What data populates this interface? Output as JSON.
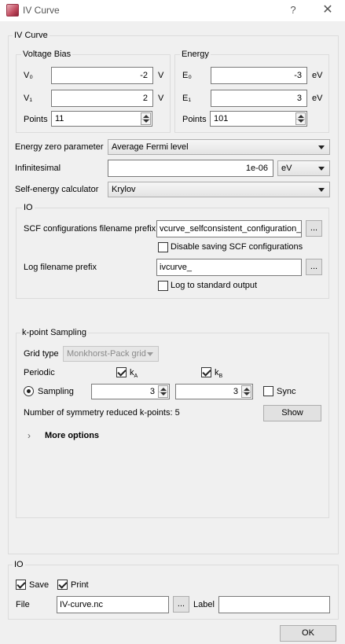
{
  "window": {
    "title": "IV Curve",
    "help": "?",
    "close": "✕"
  },
  "iv_curve": {
    "title": "IV Curve",
    "voltage_bias": {
      "title": "Voltage Bias",
      "v0_label": "V₀",
      "v0_value": "-2",
      "v0_unit": "V",
      "v1_label": "V₁",
      "v1_value": "2",
      "v1_unit": "V",
      "points_label": "Points",
      "points_value": "11"
    },
    "energy": {
      "title": "Energy",
      "e0_label": "E₀",
      "e0_value": "-3",
      "e0_unit": "eV",
      "e1_label": "E₁",
      "e1_value": "3",
      "e1_unit": "eV",
      "points_label": "Points",
      "points_value": "101"
    },
    "energy_zero": {
      "label": "Energy zero parameter",
      "value": "Average Fermi level"
    },
    "infinitesimal": {
      "label": "Infinitesimal",
      "value": "1e-06",
      "unit": "eV"
    },
    "self_energy": {
      "label": "Self-energy calculator",
      "value": "Krylov"
    },
    "io": {
      "title": "IO",
      "scf_label": "SCF configurations filename prefix",
      "scf_value": "vcurve_selfconsistent_configuration_",
      "browse": "...",
      "disable_scf_label": "Disable saving SCF configurations",
      "log_label": "Log filename prefix",
      "log_value": "ivcurve_",
      "log_stdout_label": "Log to standard output"
    },
    "kpoint": {
      "title": "k-point Sampling",
      "grid_type_label": "Grid type",
      "grid_type_value": "Monkhorst-Pack grid",
      "periodic_label": "Periodic",
      "ka_label": "kA",
      "kb_label": "kB",
      "sampling_label": "Sampling",
      "sampling_a": "3",
      "sampling_b": "3",
      "sync_label": "Sync",
      "reduced_label": "Number of symmetry reduced k-points: 5",
      "show_button": "Show",
      "more_options": "More options"
    }
  },
  "output_io": {
    "title": "IO",
    "save_label": "Save",
    "print_label": "Print",
    "file_label": "File",
    "file_value": "IV-curve.nc",
    "browse": "...",
    "label_label": "Label",
    "label_value": ""
  },
  "ok_button": "OK"
}
